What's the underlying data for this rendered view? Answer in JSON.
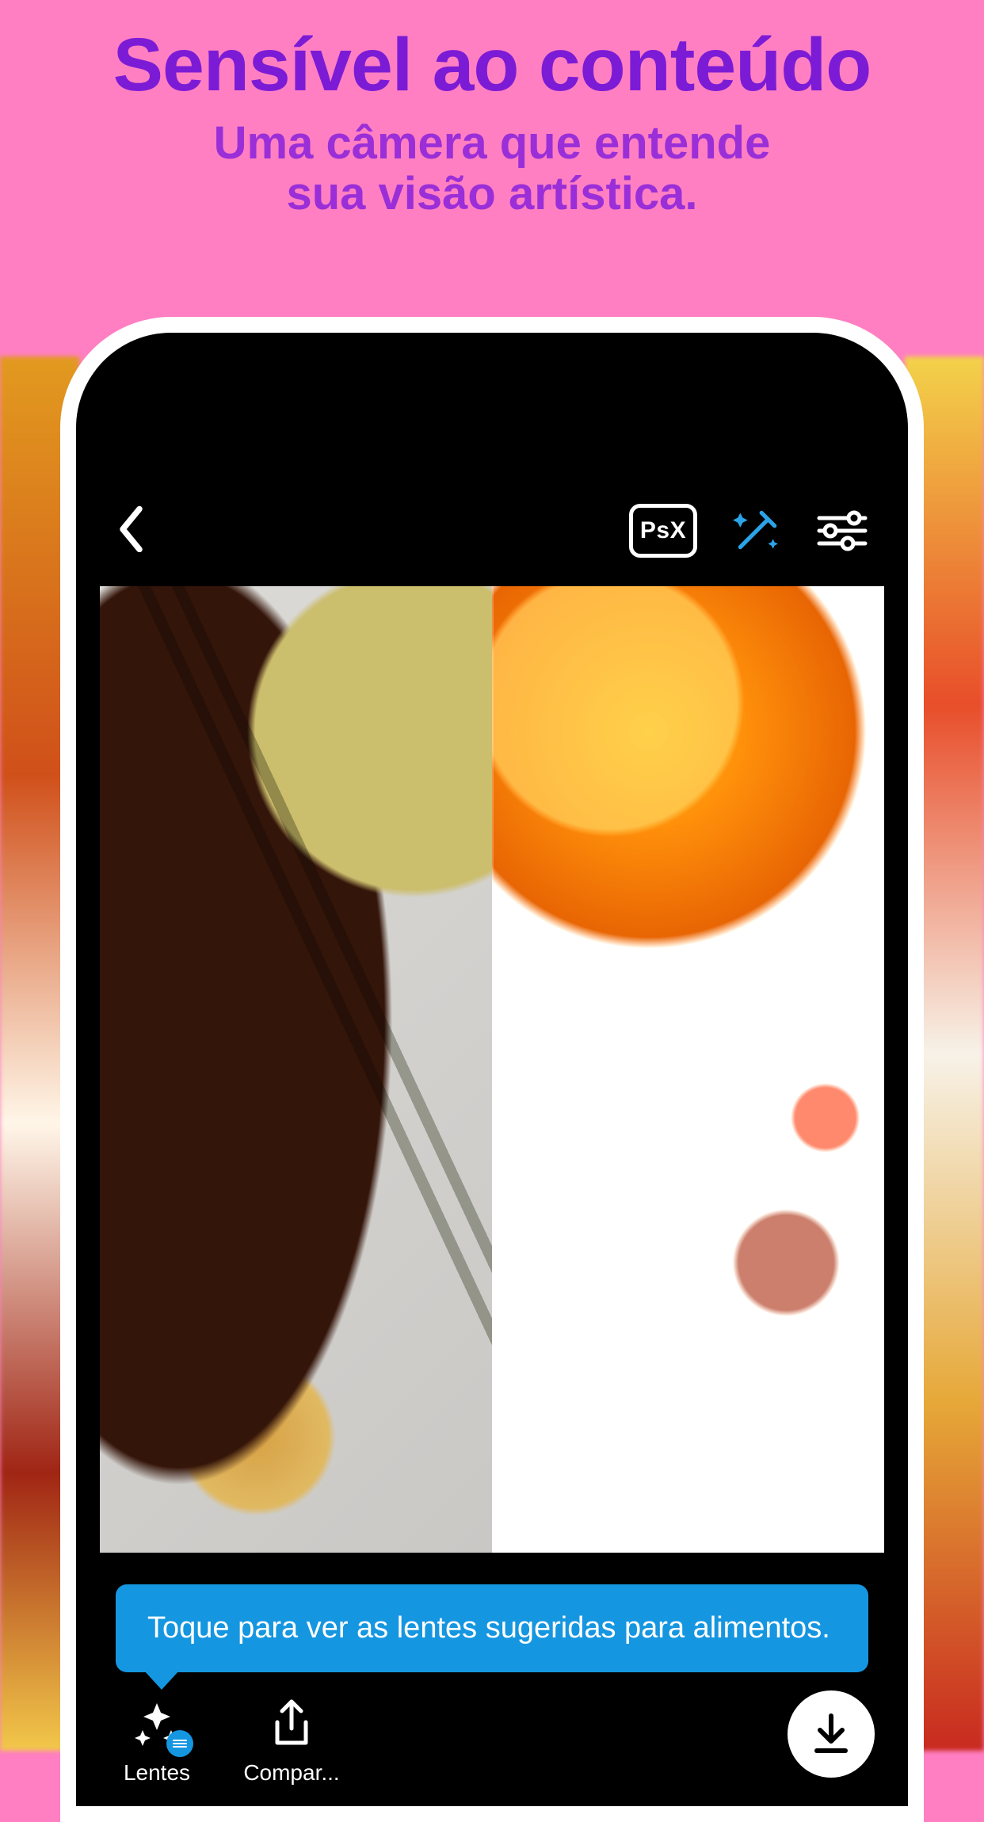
{
  "hero": {
    "title": "Sensível ao conteúdo",
    "subtitle_line1": "Uma câmera que entende",
    "subtitle_line2": "sua visão artística."
  },
  "topbar": {
    "psx_label": "PsX"
  },
  "tooltip": {
    "text": "Toque para ver as lentes sugeridas para alimentos."
  },
  "bottom": {
    "lenses_label": "Lentes",
    "share_label": "Compar..."
  },
  "colors": {
    "page_bg": "#ff7fc2",
    "title": "#7c1bd6",
    "subtitle": "#9a2ed8",
    "tooltip_bg": "#1596e0",
    "accent_blue": "#2aa3e8"
  }
}
